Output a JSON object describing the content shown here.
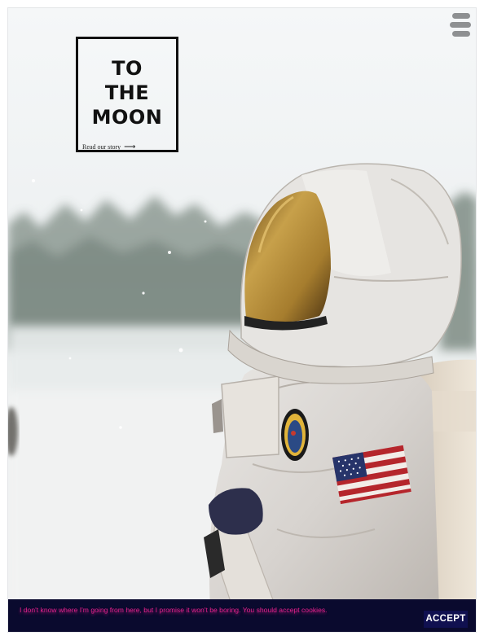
{
  "logo": {
    "title_lines": [
      "TO",
      "THE",
      "MOON"
    ],
    "link_label": "Read our story",
    "link_arrow": "⟶"
  },
  "menu": {
    "icon": "hamburger-menu-icon"
  },
  "hero": {
    "image": "astronaut-in-snowy-forest"
  },
  "cookie": {
    "message": "I don't know where I'm going from here, but I promise it won't be boring. You should accept cookies.",
    "accept_label": "ACCEPT"
  },
  "colors": {
    "cookie_bg": "#0a0a2e",
    "cookie_text": "#e0218a",
    "accept_bg": "#101050",
    "logo_border": "#111111"
  }
}
